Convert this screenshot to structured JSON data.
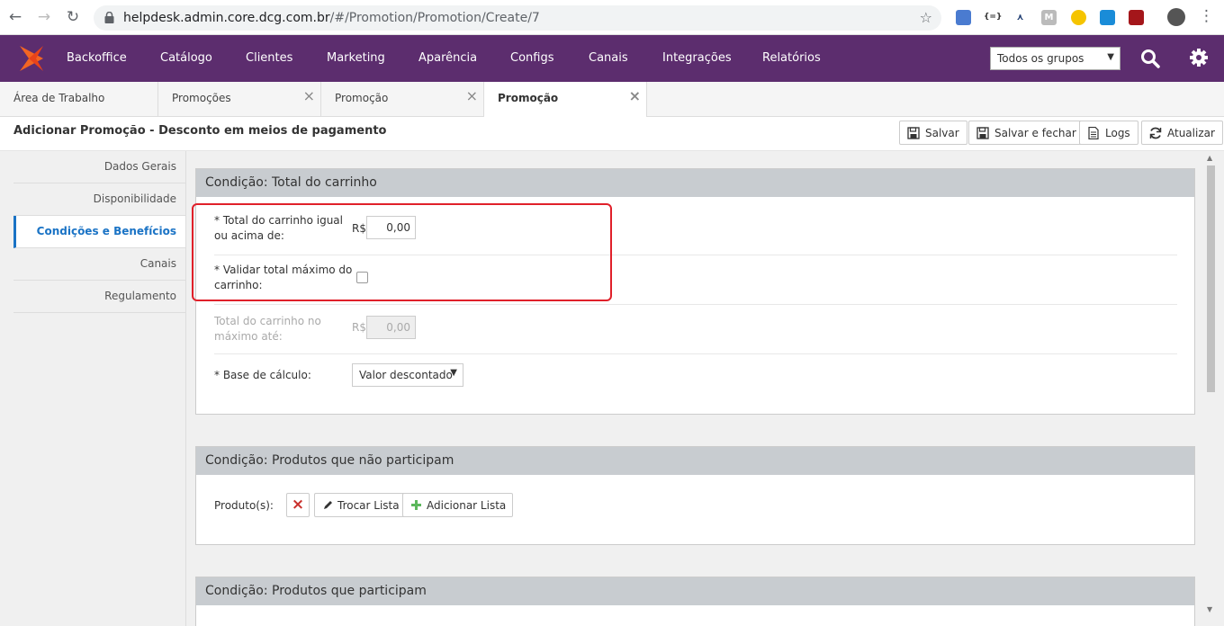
{
  "browser": {
    "url_host": "helpdesk.admin.core.dcg.com.br",
    "url_path": "/#/Promotion/Promotion/Create/7",
    "back": "←",
    "forward": "→",
    "reload": "↻",
    "star": "☆",
    "menu": "⋮"
  },
  "nav": {
    "items": [
      "Backoffice",
      "Catálogo",
      "Clientes",
      "Marketing",
      "Aparência",
      "Configs",
      "Canais",
      "Integrações",
      "Relatórios"
    ],
    "group_select": "Todos os grupos"
  },
  "tabs": [
    {
      "label": "Área de Trabalho",
      "closable": false
    },
    {
      "label": "Promoções",
      "closable": true
    },
    {
      "label": "Promoção",
      "closable": true
    },
    {
      "label": "Promoção",
      "closable": true,
      "active": true
    }
  ],
  "header": {
    "title": "Adicionar Promoção - Desconto em meios de pagamento",
    "buttons": [
      "Salvar",
      "Salvar e fechar",
      "Logs",
      "Atualizar"
    ]
  },
  "sidebar": {
    "items": [
      "Dados Gerais",
      "Disponibilidade",
      "Condições e Benefícios",
      "Canais",
      "Regulamento"
    ],
    "active_index": 2
  },
  "panel1": {
    "title": "Condição: Total do carrinho",
    "min_label_1": "* Total do carrinho igual",
    "min_label_2": "ou acima de:",
    "currency": "R$",
    "min_value": "0,00",
    "validate_label_1": "* Validar total máximo do",
    "validate_label_2": "carrinho:",
    "validate_checked": false,
    "max_label_1": "Total do carrinho no",
    "max_label_2": "máximo até:",
    "max_value": "0,00",
    "base_label": "* Base de cálculo:",
    "base_value": "Valor descontado"
  },
  "panel2": {
    "title": "Condição: Produtos que não participam",
    "products_label": "Produto(s):",
    "remove_icon": "×",
    "swap_label": "Trocar Lista",
    "add_label": "Adicionar Lista"
  },
  "panel3": {
    "title": "Condição: Produtos que participam"
  },
  "colors": {
    "nav_bg": "#5c2d6e",
    "active_blue": "#1a73c5",
    "highlight_red": "#e0202a",
    "logo_orange": "#f26522"
  }
}
